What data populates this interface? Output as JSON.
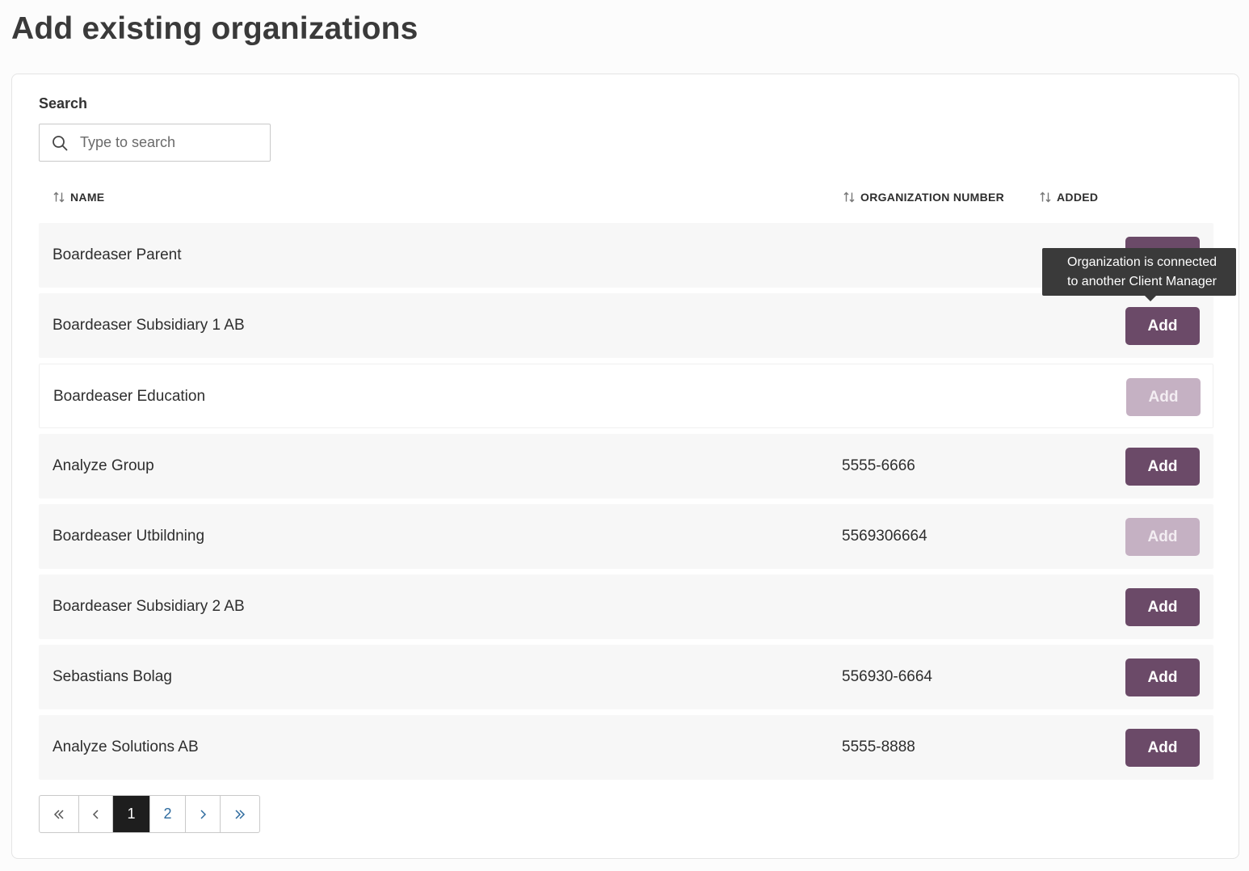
{
  "page": {
    "title": "Add existing organizations"
  },
  "search": {
    "label": "Search",
    "placeholder": "Type to search",
    "value": ""
  },
  "table": {
    "columns": {
      "name": "NAME",
      "org_number": "ORGANIZATION NUMBER",
      "added": "ADDED"
    },
    "add_label": "Add",
    "rows": [
      {
        "name": "Boardeaser Parent",
        "org_number": "",
        "disabled": false
      },
      {
        "name": "Boardeaser Subsidiary 1 AB",
        "org_number": "",
        "disabled": false
      },
      {
        "name": "Boardeaser Education",
        "org_number": "",
        "disabled": true
      },
      {
        "name": "Analyze Group",
        "org_number": "5555-6666",
        "disabled": false
      },
      {
        "name": "Boardeaser Utbildning",
        "org_number": "5569306664",
        "disabled": true
      },
      {
        "name": "Boardeaser Subsidiary 2 AB",
        "org_number": "",
        "disabled": false
      },
      {
        "name": "Sebastians Bolag",
        "org_number": "556930-6664",
        "disabled": false
      },
      {
        "name": "Analyze Solutions AB",
        "org_number": "5555-8888",
        "disabled": false
      }
    ]
  },
  "tooltip": {
    "line1": "Organization is connected",
    "line2": "to another Client Manager"
  },
  "pagination": {
    "pages": [
      "1",
      "2"
    ],
    "current": "1"
  },
  "icons": {
    "search": "search-icon",
    "sort": "sort-icon",
    "first": "double-chevron-left-icon",
    "prev": "chevron-left-icon",
    "next": "chevron-right-icon",
    "last": "double-chevron-right-icon"
  },
  "colors": {
    "primary_button": "#6b4a68",
    "disabled_button": "#c5b1c3",
    "tooltip_bg": "#3a3a3a",
    "active_page": "#1e1e1e",
    "page_link": "#2d6a9e"
  }
}
